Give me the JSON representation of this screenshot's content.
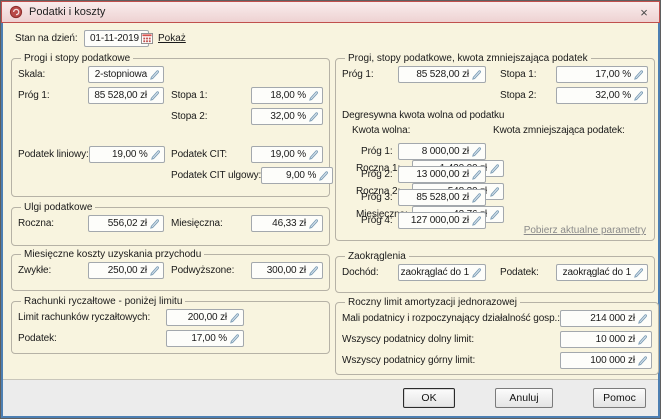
{
  "dialog": {
    "title": "Podatki i koszty",
    "close_glyph": "×"
  },
  "header": {
    "date_label": "Stan na dzień:",
    "date_value": "01-11-2019",
    "show_link": "Pokaż"
  },
  "progi_stopy": {
    "title": "Progi i stopy podatkowe",
    "skala_label": "Skala:",
    "skala_value": "2-stopniowa",
    "prog1_label": "Próg 1:",
    "prog1_value": "85 528,00 zł",
    "stopa1_label": "Stopa 1:",
    "stopa1_value": "18,00 %",
    "stopa2_label": "Stopa 2:",
    "stopa2_value": "32,00 %",
    "liniowy_label": "Podatek liniowy:",
    "liniowy_value": "19,00 %",
    "cit_label": "Podatek CIT:",
    "cit_value": "19,00 %",
    "cit_ulgowy_label": "Podatek CIT ulgowy:",
    "cit_ulgowy_value": "9,00 %"
  },
  "ulgi": {
    "title": "Ulgi podatkowe",
    "roczna_label": "Roczna:",
    "roczna_value": "556,02 zł",
    "miesieczna_label": "Miesięczna:",
    "miesieczna_value": "46,33 zł"
  },
  "koszty": {
    "title": "Miesięczne koszty uzyskania przychodu",
    "zwykle_label": "Zwykłe:",
    "zwykle_value": "250,00 zł",
    "podwyzszone_label": "Podwyższone:",
    "podwyzszone_value": "300,00 zł"
  },
  "rachunki": {
    "title": "Rachunki ryczałtowe - poniżej limitu",
    "limit_label": "Limit rachunków ryczałtowych:",
    "limit_value": "200,00 zł",
    "podatek_label": "Podatek:",
    "podatek_value": "17,00 %"
  },
  "progi_kwota": {
    "title": "Progi, stopy podatkowe, kwota zmniejszająca podatek",
    "prog1_label": "Próg 1:",
    "prog1_value": "85 528,00 zł",
    "stopa1_label": "Stopa 1:",
    "stopa1_value": "17,00 %",
    "stopa2_label": "Stopa 2:",
    "stopa2_value": "32,00 %",
    "degresywna_title": "Degresywna kwota wolna od podatku",
    "kwota_wolna_header": "Kwota wolna:",
    "kwota_zmn_header": "Kwota zmniejszająca podatek:",
    "dprog1_label": "Próg 1:",
    "dprog1_value": "8 000,00 zł",
    "dprog2_label": "Próg 2:",
    "dprog2_value": "13 000,00 zł",
    "dprog3_label": "Próg 3:",
    "dprog3_value": "85 528,00 zł",
    "dprog4_label": "Próg 4:",
    "dprog4_value": "127 000,00 zł",
    "roczna1_label": "Roczna 1:",
    "roczna1_value": "1 420,00 zł",
    "roczna2_label": "Roczna 2:",
    "roczna2_value": "548,30 zł",
    "miesieczna_label": "Miesięczna:",
    "miesieczna_value": "43,76 zł",
    "link_label": "Pobierz aktualne parametry"
  },
  "zaokraglenia": {
    "title": "Zaokrąglenia",
    "dochod_label": "Dochód:",
    "dochod_value": "zaokrąglać do 1",
    "podatek_label": "Podatek:",
    "podatek_value": "zaokrąglać do 1"
  },
  "limit_amortyzacji": {
    "title": "Roczny limit amortyzacji jednorazowej",
    "mali_label": "Mali podatnicy i rozpoczynający działalność gosp.:",
    "mali_value": "214 000 zł",
    "dolny_label": "Wszyscy podatnicy dolny limit:",
    "dolny_value": "10 000 zł",
    "gorny_label": "Wszyscy podatnicy górny limit:",
    "gorny_value": "100 000 zł"
  },
  "footer": {
    "ok": "OK",
    "cancel": "Anuluj",
    "help": "Pomoc"
  },
  "colors": {
    "accent_red": "#c0504d",
    "frame_blue": "#4d7fb2",
    "body_cream": "#f8f4df",
    "footer_gray": "#ececec"
  }
}
